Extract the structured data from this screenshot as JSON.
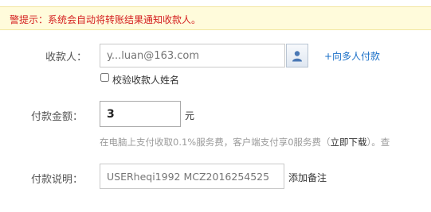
{
  "notice": {
    "text": "警提示：系统会自动将转账结果通知收款人。"
  },
  "payee": {
    "label": "收款人：",
    "placeholder": "y...luan@163.com",
    "contacts_icon": "contacts-person-icon",
    "multi_link": "+向多人付款",
    "verify_label": "校验收款人姓名",
    "verify_checked": false
  },
  "amount": {
    "label": "付款金额：",
    "value": "3",
    "unit": "元",
    "fee_hint_prefix": "在电脑上支付收取0.1%服务费，客户端支付享0服务费（",
    "fee_hint_link": "立即下载",
    "fee_hint_suffix": "）。查"
  },
  "note": {
    "label": "付款说明：",
    "placeholder": "USERheqi1992 MCZ2016254525",
    "add_note_link": "添加备注"
  }
}
